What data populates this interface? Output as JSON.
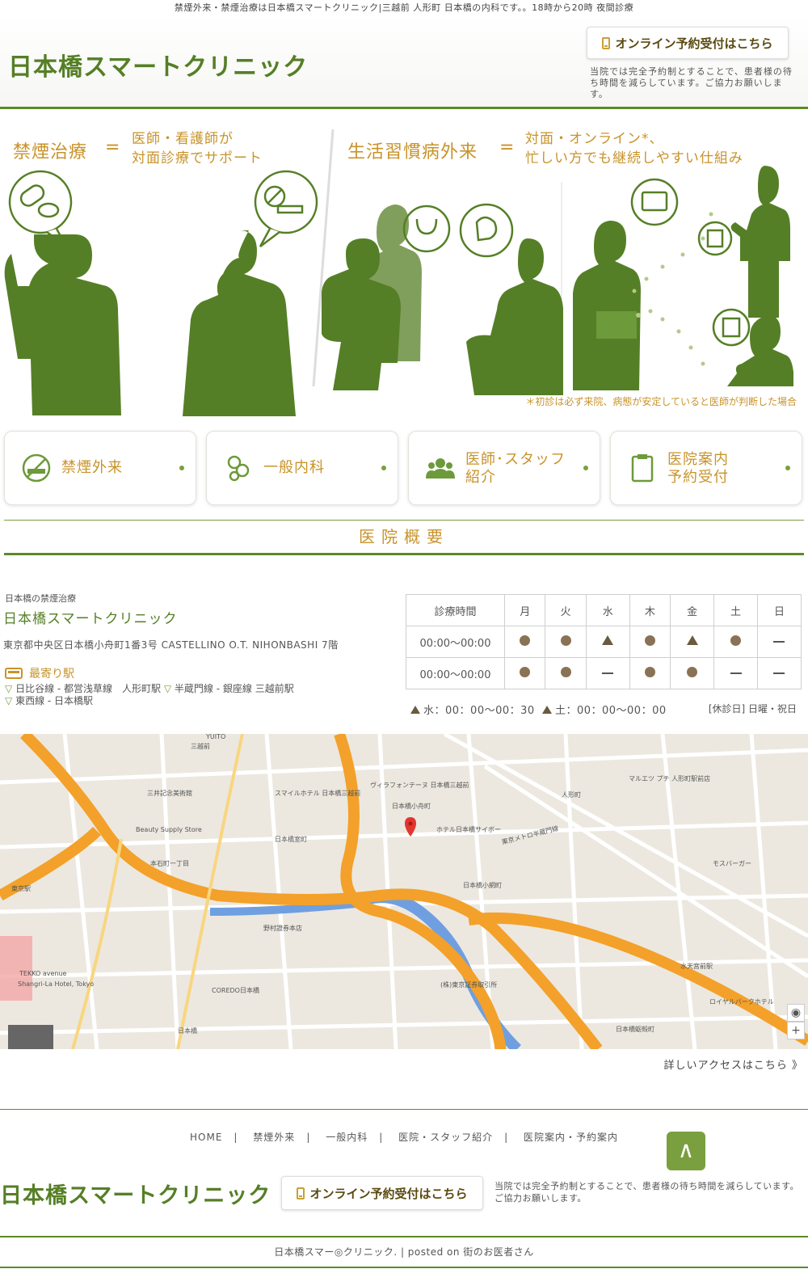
{
  "topbar": {
    "text": "禁煙外来・禁煙治療は日本橋スマートクリニック|三越前 人形町 日本橋の内科です。。18時から20時 夜間診療"
  },
  "header": {
    "logo": "日本橋スマートクリニック",
    "reserve_label": "オンライン予約受付はこちら",
    "note": "当院では完全予約制とすることで、患者様の待ち時間を減らしています。ご協力お願いします。"
  },
  "hero": {
    "left_title": "禁煙治療",
    "left_eq": "=",
    "left_sub_line1": "医師・看護師が",
    "left_sub_line2": "対面診療でサポート",
    "right_title": "生活習慣病外来",
    "right_eq": "=",
    "right_sub_line1": "対面・オンライン*、",
    "right_sub_line2": "忙しい方でも継続しやすい仕組み",
    "note": "＊初診は必ず来院、病態が安定していると医師が判断した場合",
    "color": "#557f26"
  },
  "nav_cards": [
    {
      "line1": "禁煙外来",
      "line2": "",
      "icon": "no-smoking-icon"
    },
    {
      "line1": "一般内科",
      "line2": "",
      "icon": "stethoscope-icon"
    },
    {
      "line1": "医師･スタッフ",
      "line2": "紹介",
      "icon": "people-icon"
    },
    {
      "line1": "医院案内",
      "line2": "予約受付",
      "icon": "clipboard-icon"
    }
  ],
  "overview": {
    "heading": "医院概要",
    "sub": "日本橋の禁煙治療",
    "name": "日本橋スマートクリニック",
    "address": "東京都中央区日本橋小舟町1番3号 CASTELLINO O.T. NIHONBASHI 7階",
    "station_title": "最寄り駅",
    "stations": [
      "日比谷線 - 都営浅草線　人形町駅",
      "半蔵門線 - 銀座線 三越前駅",
      "東西線 - 日本橋駅"
    ]
  },
  "hours": {
    "header": [
      "診療時間",
      "月",
      "火",
      "水",
      "木",
      "金",
      "土",
      "日"
    ],
    "rows": [
      {
        "time": "00:00〜00:00",
        "marks": [
          "circle",
          "circle",
          "triangle",
          "circle",
          "triangle",
          "circle",
          "dash"
        ]
      },
      {
        "time": "00:00〜00:00",
        "marks": [
          "circle",
          "circle",
          "dash",
          "circle",
          "circle",
          "dash",
          "dash"
        ]
      }
    ],
    "note_wed": "水：00：00〜00：30",
    "note_sat": "土：00：00〜00：00",
    "holiday": "[休診日] 日曜・祝日"
  },
  "map": {
    "labels": {
      "mitsukoshimae": "三越前",
      "ningyocho": "人形町",
      "nihonbashi": "日本橋",
      "kodenmacho": "日本橋小舟町",
      "kitamuro": "日本橋室町",
      "koamicho": "日本橋小網町",
      "kakigaracho": "日本橋蛎殻町",
      "mitsui": "三井記念美術館",
      "beauty": "Beauty Supply Store",
      "hongo": "本石町一丁目",
      "tokyo_station": "東京駅",
      "shangri": "Shangri-La Hotel, Tokyo",
      "tekko": "TEKKO avenue",
      "coredo": "COREDO日本橋",
      "nomura": "野村證券本店",
      "tokyo_exchange": "(株)東京証券取引所",
      "suitengu": "水天宮前駅",
      "royal": "ロイヤルパークホテル",
      "hotel": "ホテル日本橋サイボー",
      "hanzomon": "東京メトロ半蔵門線",
      "yuito": "YUITO",
      "mosburger": "モスバーガー",
      "marue": "マルエツ プチ 人形町駅前店",
      "villa": "ヴィラフォンテーヌ 日本橋三越前",
      "smile": "スマイルホテル 日本橋三越前"
    }
  },
  "access_link": "詳しいアクセスはこちら 》",
  "footer": {
    "nav": [
      "HOME",
      "禁煙外来",
      "一般内科",
      "医院・スタッフ紹介",
      "医院案内・予約案内"
    ],
    "separator": "|",
    "to_top": "∧",
    "logo": "日本橋スマートクリニック",
    "reserve_label": "オンライン予約受付はこちら",
    "note": "当院では完全予約制とすることで、患者様の待ち時間を減らしています。ご協力お願いします。",
    "copyright": "日本橋スマー◎クリニック. | posted on 街のお医者さん"
  },
  "colors": {
    "brand_green": "#557f26",
    "accent_gold": "#c8932a",
    "map_highway": "#f3a12a",
    "map_water": "#6f9fe0"
  }
}
